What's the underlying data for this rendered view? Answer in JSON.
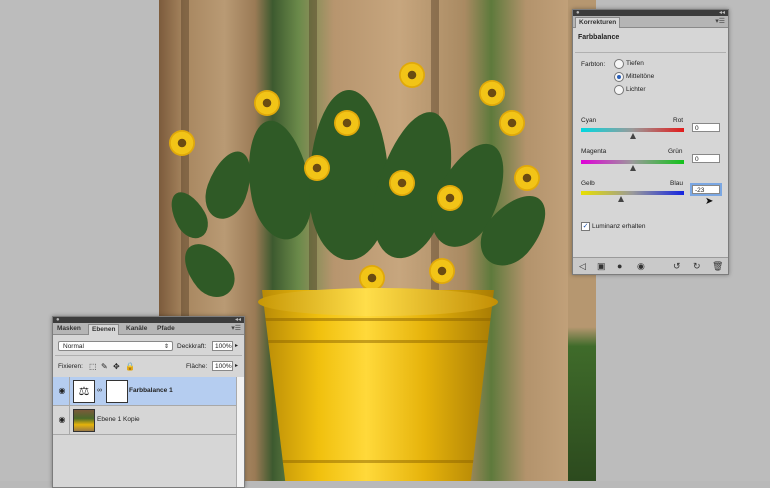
{
  "korrekturen": {
    "tab_label": "Korrekturen",
    "heading": "Farbbalance",
    "farbton_label": "Farbton:",
    "tones": [
      {
        "label": "Tiefen",
        "selected": false
      },
      {
        "label": "Mitteltöne",
        "selected": true
      },
      {
        "label": "Lichter",
        "selected": false
      }
    ],
    "sliders": [
      {
        "left": "Cyan",
        "right": "Rot",
        "value": "0",
        "position": 0.5
      },
      {
        "left": "Magenta",
        "right": "Grün",
        "value": "0",
        "position": 0.5
      },
      {
        "left": "Gelb",
        "right": "Blau",
        "value": "-23",
        "position": 0.385
      }
    ],
    "preserve_luminance_label": "Luminanz erhalten",
    "preserve_luminance_checked": true
  },
  "ebenen": {
    "tabs": [
      "Masken",
      "Ebenen",
      "Kanäle",
      "Pfade"
    ],
    "active_tab": "Ebenen",
    "blend_mode": "Normal",
    "opacity_label": "Deckkraft:",
    "opacity_value": "100%",
    "lock_label": "Fixieren:",
    "fill_label": "Fläche:",
    "fill_value": "100%",
    "layers": [
      {
        "name": "Farbbalance 1",
        "selected": true
      },
      {
        "name": "Ebene 1 Kopie",
        "selected": false
      }
    ]
  },
  "colors": {
    "panel_bg": "#d6d6d6",
    "selection": "#b5cdf0",
    "pot_yellow": "#f1c10f"
  }
}
